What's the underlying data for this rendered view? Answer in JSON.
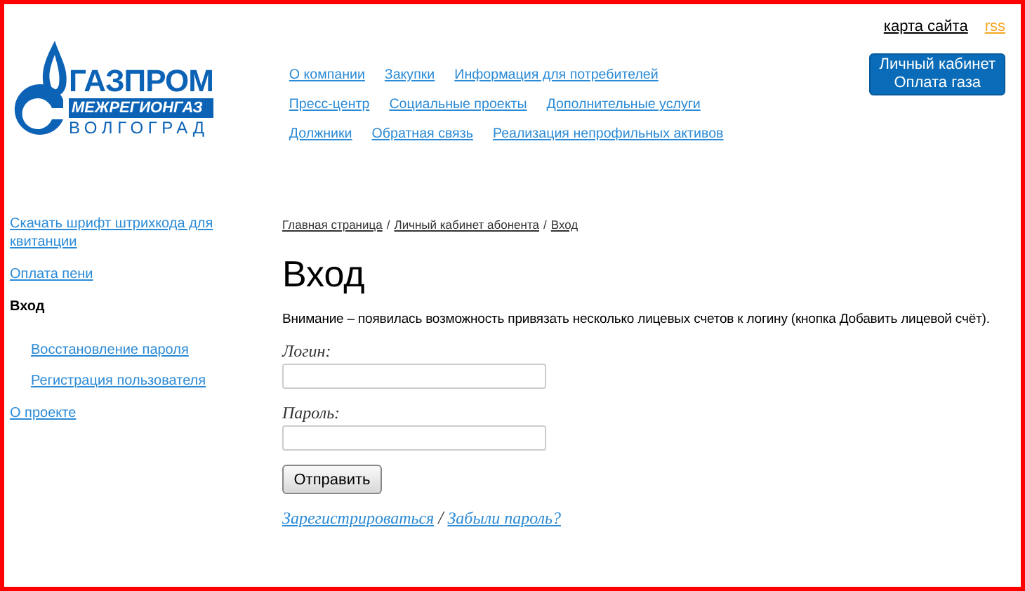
{
  "header": {
    "logo": {
      "name": "ГАЗПРОМ",
      "band": "МЕЖРЕГИОНГАЗ",
      "city": "ВОЛГОГРАД"
    },
    "top_links": [
      {
        "label": "карта сайта",
        "kind": "plain"
      },
      {
        "label": "rss",
        "kind": "rss"
      }
    ],
    "nav_rows": [
      [
        "О компании",
        "Закупки",
        "Информация для потребителей"
      ],
      [
        "Пресс-центр",
        "Социальные проекты",
        "Дополнительные услуги"
      ],
      [
        "Должники",
        "Обратная связь",
        "Реализация непрофильных активов"
      ]
    ],
    "cabinet_button": [
      "Личный кабинет",
      "Оплата газа"
    ]
  },
  "sidebar": {
    "items": [
      {
        "label": "Скачать шрифт штрихкода для квитанции",
        "selected": false
      },
      {
        "label": "Оплата пени",
        "selected": false
      },
      {
        "label": "Вход",
        "selected": true,
        "children": [
          {
            "label": "Восстановление пароля",
            "selected": false
          },
          {
            "label": "Регистрация пользователя",
            "selected": false
          }
        ]
      },
      {
        "label": "О проекте",
        "selected": false
      }
    ]
  },
  "breadcrumbs": {
    "separator": "/",
    "items": [
      "Главная страница",
      "Личный кабинет абонента",
      "Вход"
    ]
  },
  "title": "Вход",
  "notice": "Внимание – появилась возможность привязать несколько лицевых счетов к логину (кнопка Добавить лицевой счёт).",
  "form": {
    "fields": [
      {
        "label": "Логин:"
      },
      {
        "label": "Пароль:"
      }
    ],
    "submit": "Отправить",
    "links": [
      "Зарегистрироваться",
      "Забыли пароль?"
    ],
    "links_separator": "/"
  }
}
